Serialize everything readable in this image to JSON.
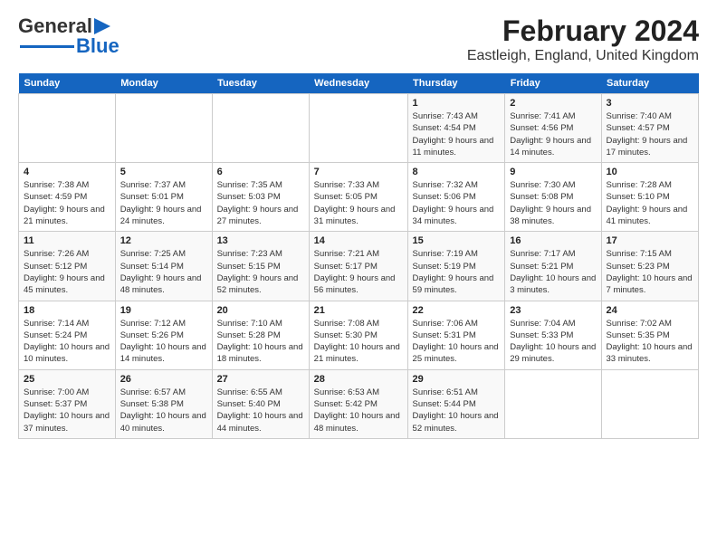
{
  "header": {
    "logo_general": "General",
    "logo_blue": "Blue",
    "title": "February 2024",
    "subtitle": "Eastleigh, England, United Kingdom"
  },
  "days_of_week": [
    "Sunday",
    "Monday",
    "Tuesday",
    "Wednesday",
    "Thursday",
    "Friday",
    "Saturday"
  ],
  "weeks": [
    [
      {
        "day": "",
        "sunrise": "",
        "sunset": "",
        "daylight": ""
      },
      {
        "day": "",
        "sunrise": "",
        "sunset": "",
        "daylight": ""
      },
      {
        "day": "",
        "sunrise": "",
        "sunset": "",
        "daylight": ""
      },
      {
        "day": "",
        "sunrise": "",
        "sunset": "",
        "daylight": ""
      },
      {
        "day": "1",
        "sunrise": "7:43 AM",
        "sunset": "4:54 PM",
        "daylight": "9 hours and 11 minutes."
      },
      {
        "day": "2",
        "sunrise": "7:41 AM",
        "sunset": "4:56 PM",
        "daylight": "9 hours and 14 minutes."
      },
      {
        "day": "3",
        "sunrise": "7:40 AM",
        "sunset": "4:57 PM",
        "daylight": "9 hours and 17 minutes."
      }
    ],
    [
      {
        "day": "4",
        "sunrise": "7:38 AM",
        "sunset": "4:59 PM",
        "daylight": "9 hours and 21 minutes."
      },
      {
        "day": "5",
        "sunrise": "7:37 AM",
        "sunset": "5:01 PM",
        "daylight": "9 hours and 24 minutes."
      },
      {
        "day": "6",
        "sunrise": "7:35 AM",
        "sunset": "5:03 PM",
        "daylight": "9 hours and 27 minutes."
      },
      {
        "day": "7",
        "sunrise": "7:33 AM",
        "sunset": "5:05 PM",
        "daylight": "9 hours and 31 minutes."
      },
      {
        "day": "8",
        "sunrise": "7:32 AM",
        "sunset": "5:06 PM",
        "daylight": "9 hours and 34 minutes."
      },
      {
        "day": "9",
        "sunrise": "7:30 AM",
        "sunset": "5:08 PM",
        "daylight": "9 hours and 38 minutes."
      },
      {
        "day": "10",
        "sunrise": "7:28 AM",
        "sunset": "5:10 PM",
        "daylight": "9 hours and 41 minutes."
      }
    ],
    [
      {
        "day": "11",
        "sunrise": "7:26 AM",
        "sunset": "5:12 PM",
        "daylight": "9 hours and 45 minutes."
      },
      {
        "day": "12",
        "sunrise": "7:25 AM",
        "sunset": "5:14 PM",
        "daylight": "9 hours and 48 minutes."
      },
      {
        "day": "13",
        "sunrise": "7:23 AM",
        "sunset": "5:15 PM",
        "daylight": "9 hours and 52 minutes."
      },
      {
        "day": "14",
        "sunrise": "7:21 AM",
        "sunset": "5:17 PM",
        "daylight": "9 hours and 56 minutes."
      },
      {
        "day": "15",
        "sunrise": "7:19 AM",
        "sunset": "5:19 PM",
        "daylight": "9 hours and 59 minutes."
      },
      {
        "day": "16",
        "sunrise": "7:17 AM",
        "sunset": "5:21 PM",
        "daylight": "10 hours and 3 minutes."
      },
      {
        "day": "17",
        "sunrise": "7:15 AM",
        "sunset": "5:23 PM",
        "daylight": "10 hours and 7 minutes."
      }
    ],
    [
      {
        "day": "18",
        "sunrise": "7:14 AM",
        "sunset": "5:24 PM",
        "daylight": "10 hours and 10 minutes."
      },
      {
        "day": "19",
        "sunrise": "7:12 AM",
        "sunset": "5:26 PM",
        "daylight": "10 hours and 14 minutes."
      },
      {
        "day": "20",
        "sunrise": "7:10 AM",
        "sunset": "5:28 PM",
        "daylight": "10 hours and 18 minutes."
      },
      {
        "day": "21",
        "sunrise": "7:08 AM",
        "sunset": "5:30 PM",
        "daylight": "10 hours and 21 minutes."
      },
      {
        "day": "22",
        "sunrise": "7:06 AM",
        "sunset": "5:31 PM",
        "daylight": "10 hours and 25 minutes."
      },
      {
        "day": "23",
        "sunrise": "7:04 AM",
        "sunset": "5:33 PM",
        "daylight": "10 hours and 29 minutes."
      },
      {
        "day": "24",
        "sunrise": "7:02 AM",
        "sunset": "5:35 PM",
        "daylight": "10 hours and 33 minutes."
      }
    ],
    [
      {
        "day": "25",
        "sunrise": "7:00 AM",
        "sunset": "5:37 PM",
        "daylight": "10 hours and 37 minutes."
      },
      {
        "day": "26",
        "sunrise": "6:57 AM",
        "sunset": "5:38 PM",
        "daylight": "10 hours and 40 minutes."
      },
      {
        "day": "27",
        "sunrise": "6:55 AM",
        "sunset": "5:40 PM",
        "daylight": "10 hours and 44 minutes."
      },
      {
        "day": "28",
        "sunrise": "6:53 AM",
        "sunset": "5:42 PM",
        "daylight": "10 hours and 48 minutes."
      },
      {
        "day": "29",
        "sunrise": "6:51 AM",
        "sunset": "5:44 PM",
        "daylight": "10 hours and 52 minutes."
      },
      {
        "day": "",
        "sunrise": "",
        "sunset": "",
        "daylight": ""
      },
      {
        "day": "",
        "sunrise": "",
        "sunset": "",
        "daylight": ""
      }
    ]
  ]
}
